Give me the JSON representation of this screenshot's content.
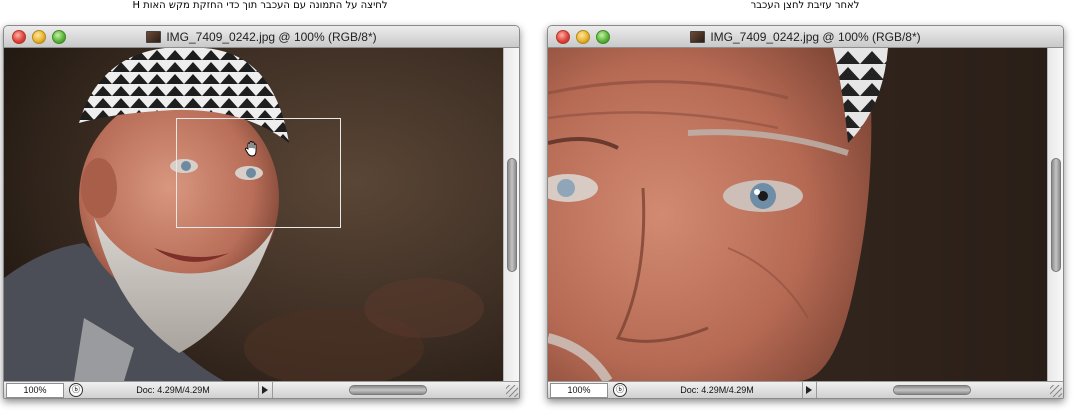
{
  "captions": {
    "left": "לחיצה על התמונה עם העכבר תוך כדי החזקת מקש האות H",
    "right": "לאחר עזיבת לחצן העכבר"
  },
  "windows": [
    {
      "title": "IMG_7409_0242.jpg @ 100% (RGB/8*)",
      "zoom_value": "100%",
      "doc_info": "Doc: 4.29M/4.29M"
    },
    {
      "title": "IMG_7409_0242.jpg @ 100% (RGB/8*)",
      "zoom_value": "100%",
      "doc_info": "Doc: 4.29M/4.29M"
    }
  ],
  "icons": {
    "traffic_close": "close-icon",
    "traffic_minimize": "minimize-icon",
    "traffic_zoom": "zoom-icon",
    "doc": "document-thumbnail-icon",
    "status_pad": "bridge-icon",
    "arrow": "play-arrow-icon",
    "hand": "hand-icon"
  },
  "colors": {
    "close": "#e0443a",
    "minimize": "#e9b52c",
    "zoom": "#5bb63b"
  }
}
